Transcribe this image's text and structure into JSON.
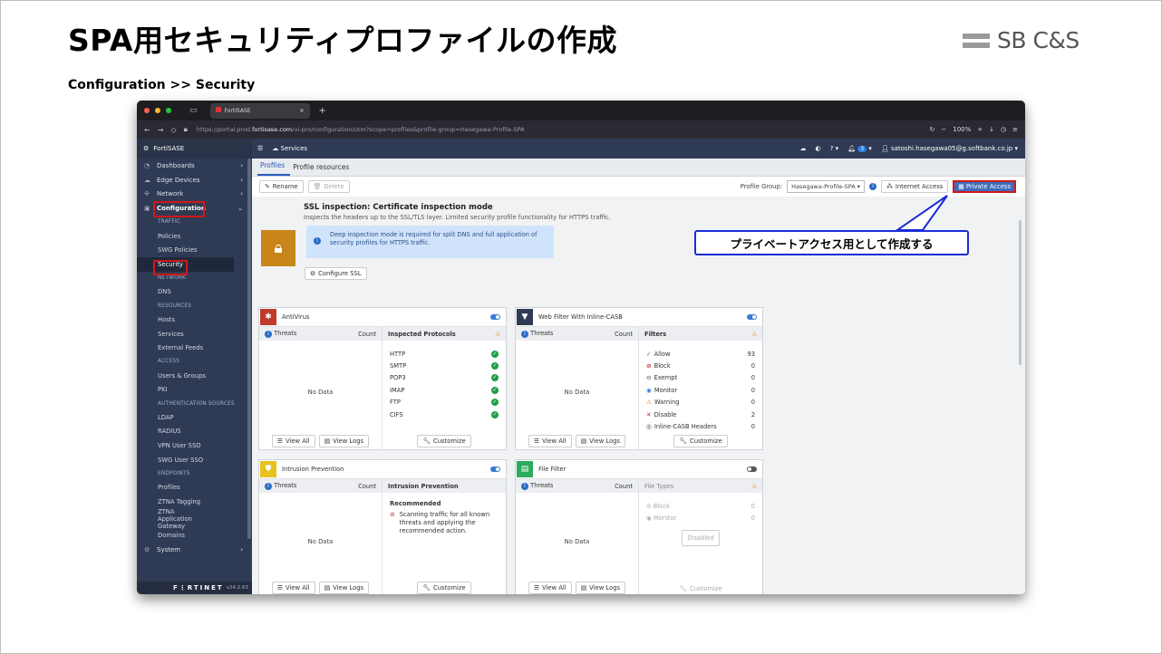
{
  "slide": {
    "title": "SPA用セキュリティプロファイルの作成",
    "subtitle": "Configuration >> Security",
    "logo": "SB C&S"
  },
  "browser": {
    "tab_title": "FortiSASE",
    "url_prefix": "https://portal.prod.",
    "url_domain": "fortisase.com",
    "url_suffix": "/ui-pro/configuration/utm?scope=profiles&profile-group=Hasegawa-Profile-SPA",
    "zoom": "100%"
  },
  "sidebar": {
    "brand": "FortiSASE",
    "items": [
      {
        "label": "Dashboards",
        "icon": "dashboard-icon"
      },
      {
        "label": "Edge Devices",
        "icon": "cloud-icon"
      },
      {
        "label": "Network",
        "icon": "network-icon"
      },
      {
        "label": "Configuration",
        "icon": "lock-icon"
      }
    ],
    "sections": {
      "traffic": "TRAFFIC",
      "network": "NETWORK",
      "resources": "RESOURCES",
      "access": "ACCESS",
      "auth": "AUTHENTICATION SOURCES",
      "endpoints": "ENDPOINTS"
    },
    "subs": {
      "policies": "Policies",
      "swg_policies": "SWG Policies",
      "security": "Security",
      "dns": "DNS",
      "hosts": "Hosts",
      "services": "Services",
      "external_feeds": "External Feeds",
      "users_groups": "Users & Groups",
      "pki": "PKI",
      "ldap": "LDAP",
      "radius": "RADIUS",
      "vpn_sso": "VPN User SSO",
      "swg_sso": "SWG User SSO",
      "profiles": "Profiles",
      "ztna_tagging": "ZTNA Tagging",
      "ztna_app_gw": "ZTNA Application Gateway",
      "domains": "Domains"
    },
    "system": "System",
    "footer_brand": "F⋮RTINET",
    "version": "v24.2.63"
  },
  "topbar": {
    "services": "Services",
    "notif_count": "3",
    "user": "satoshi.hasegawa05@g.softbank.co.jp"
  },
  "tabs": [
    "Profiles",
    "Profile resources"
  ],
  "toolbar": {
    "rename": "Rename",
    "delete": "Delete",
    "profile_group_label": "Profile Group:",
    "profile_group_value": "Hasegawa-Profile-SPA",
    "internet_access": "Internet Access",
    "private_access": "Private Access"
  },
  "ssl": {
    "title": "SSL inspection: Certificate inspection mode",
    "desc": "Inspects the headers up to the SSL/TLS layer. Limited security profile functionality for HTTPS traffic.",
    "note": "Deep inspection mode is required for split DNS and full application of security profiles for HTTPS traffic.",
    "button": "Configure SSL"
  },
  "common": {
    "threats": "Threats",
    "count": "Count",
    "no_data": "No Data",
    "view_all": "View All",
    "view_logs": "View Logs",
    "customize": "Customize"
  },
  "antivirus": {
    "title": "AntiVirus",
    "right_header": "Inspected Protocols",
    "protocols": [
      "HTTP",
      "SMTP",
      "POP3",
      "IMAP",
      "FTP",
      "CIFS"
    ]
  },
  "webfilter": {
    "title": "Web Filter With Inline-CASB",
    "right_header": "Filters",
    "filters": [
      {
        "label": "Allow",
        "count": "93",
        "color": "#1e9e4a"
      },
      {
        "label": "Block",
        "count": "0",
        "color": "#d0202a"
      },
      {
        "label": "Exempt",
        "count": "0",
        "color": "#777777"
      },
      {
        "label": "Monitor",
        "count": "0",
        "color": "#2a7cdf"
      },
      {
        "label": "Warning",
        "count": "0",
        "color": "#e88c1a"
      },
      {
        "label": "Disable",
        "count": "2",
        "color": "#d0202a"
      },
      {
        "label": "Inline-CASB Headers",
        "count": "0",
        "color": "#333333"
      }
    ]
  },
  "ips": {
    "title": "Intrusion Prevention",
    "right_header": "Intrusion Prevention",
    "rec_title": "Recommended",
    "rec_text": "Scanning traffic for all known threats and applying the recommended action."
  },
  "filefilter": {
    "title": "File Filter",
    "right_header": "File Types",
    "block": "Block",
    "block_count": "0",
    "monitor": "Monitor",
    "monitor_count": "0",
    "disabled": "Disabled"
  },
  "callout": "プライベートアクセス用として作成する"
}
